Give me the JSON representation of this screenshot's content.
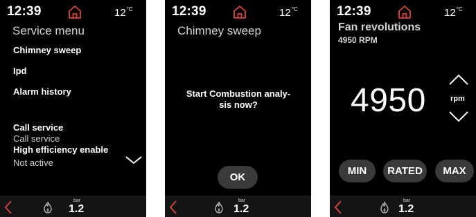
{
  "status": {
    "time": "12:39",
    "temperature": "12",
    "temperature_unit": "°C"
  },
  "bottom": {
    "pressure": "1.2",
    "pressure_unit": "bar"
  },
  "service_menu": {
    "title": "Service menu",
    "items": [
      {
        "label": "Chimney sweep"
      },
      {
        "label": "Ipd"
      },
      {
        "label": "Alarm history"
      },
      {
        "label": "Call service",
        "sublabel": "Call service"
      },
      {
        "label": "High efficiency enable",
        "sublabel": "Not active"
      }
    ]
  },
  "chimney_sweep": {
    "title": "Chimney sweep",
    "message": "Start Combustion analy-sis now?",
    "ok_label": "OK"
  },
  "fan_revolutions": {
    "title": "Fan revolutions",
    "subtitle": "4950 RPM",
    "value": "4950",
    "unit": "rpm",
    "buttons": {
      "min": "MIN",
      "rated": "RATED",
      "max": "MAX"
    }
  },
  "colors": {
    "background": "#000000",
    "accent_red": "#e0433a",
    "button_gray": "#3a3a3a",
    "text": "#ffffff"
  }
}
